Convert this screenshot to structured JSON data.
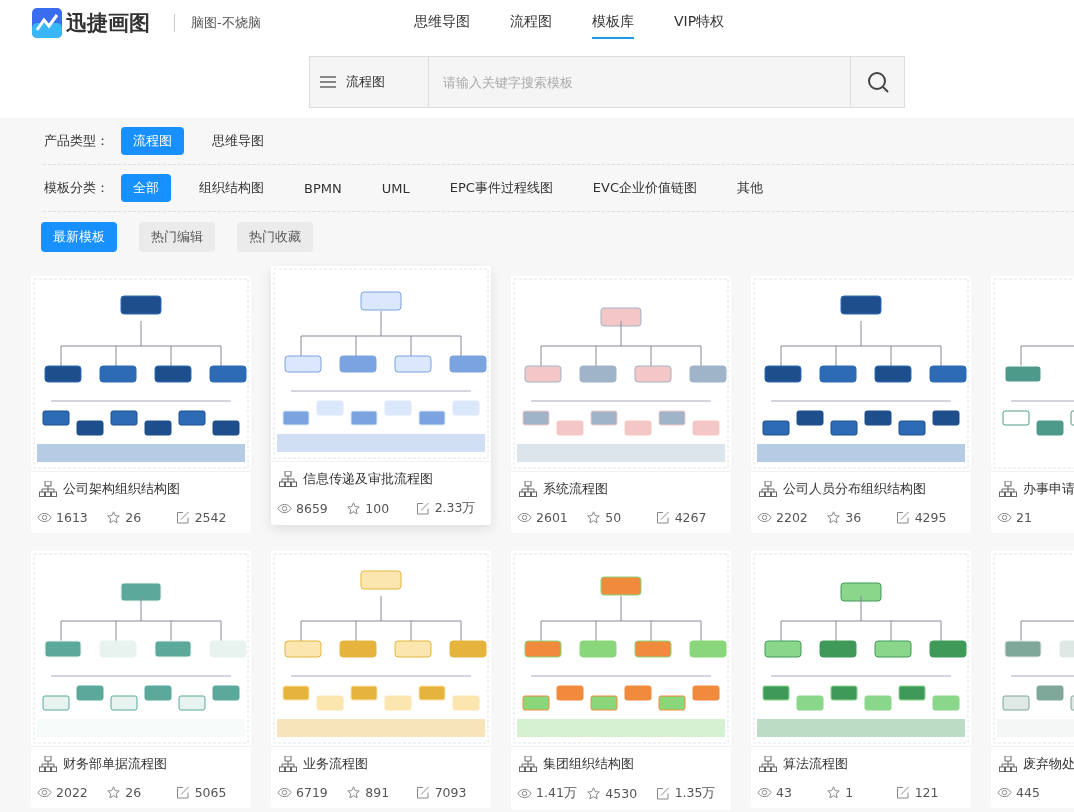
{
  "header": {
    "logo": "迅捷画图",
    "slogan": "脑图-不烧脑",
    "nav": [
      {
        "label": "思维导图",
        "selected": false
      },
      {
        "label": "流程图",
        "selected": false
      },
      {
        "label": "模板库",
        "selected": true
      },
      {
        "label": "VIP特权",
        "selected": false
      }
    ],
    "search": {
      "category": "流程图",
      "placeholder": "请输入关键字搜索模板"
    }
  },
  "filters": [
    {
      "label": "产品类型：",
      "options": [
        {
          "label": "流程图",
          "selected": true
        },
        {
          "label": "思维导图",
          "selected": false
        }
      ]
    },
    {
      "label": "模板分类：",
      "options": [
        {
          "label": "全部",
          "selected": true
        },
        {
          "label": "组织结构图",
          "selected": false
        },
        {
          "label": "BPMN",
          "selected": false
        },
        {
          "label": "UML",
          "selected": false
        },
        {
          "label": "EPC事件过程线图",
          "selected": false
        },
        {
          "label": "EVC企业价值链图",
          "selected": false
        },
        {
          "label": "其他",
          "selected": false
        }
      ]
    }
  ],
  "sort_tabs": [
    {
      "label": "最新模板",
      "selected": true
    },
    {
      "label": "热门编辑",
      "selected": false
    },
    {
      "label": "热门收藏",
      "selected": false
    }
  ],
  "templates": [
    [
      {
        "kind": "picture",
        "title": "公司架构组织结构图",
        "views": "1613",
        "stars": "26",
        "edits": "2542",
        "raised": false
      },
      {
        "kind": "picture",
        "title": "信息传递及审批流程图",
        "views": "8659",
        "stars": "100",
        "edits": "2.33万",
        "raised": true
      },
      {
        "kind": "picture",
        "title": "系统流程图",
        "views": "2601",
        "stars": "50",
        "edits": "4267",
        "raised": false
      },
      {
        "kind": "picture",
        "title": "公司人员分布组织结构图",
        "views": "2202",
        "stars": "36",
        "edits": "4295",
        "raised": false
      },
      {
        "kind": "picture",
        "title": "办事申请",
        "views": "21",
        "raised": false
      }
    ],
    [
      {
        "kind": "picture",
        "title": "财务部单据流程图",
        "views": "2022",
        "stars": "26",
        "edits": "5065",
        "raised": false
      },
      {
        "kind": "picture",
        "title": "业务流程图",
        "views": "6719",
        "stars": "891",
        "edits": "7093",
        "raised": false
      },
      {
        "kind": "picture",
        "title": "集团组织结构图",
        "views": "1.41万",
        "stars": "4530",
        "edits": "1.35万",
        "raised": false
      },
      {
        "kind": "picture",
        "title": "算法流程图",
        "views": "43",
        "stars": "1",
        "edits": "121",
        "raised": false
      },
      {
        "kind": "picture",
        "title": "废弃物处",
        "views": "445",
        "raised": false
      }
    ]
  ]
}
